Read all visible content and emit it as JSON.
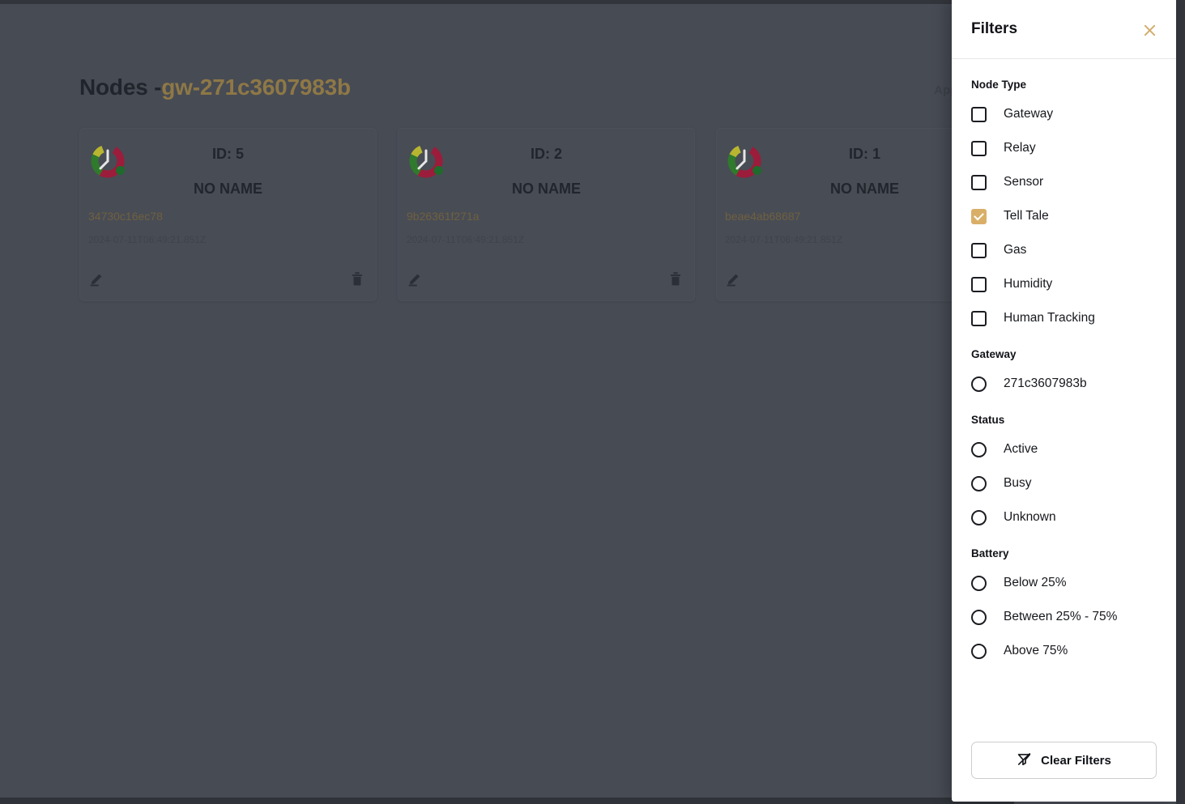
{
  "main": {
    "title_prefix": "Nodes -",
    "gateway_id": "gw-271c3607983b",
    "apply_filters_label": "Apply Filters",
    "cards": [
      {
        "id_label": "ID: 5",
        "name": "NO NAME",
        "mac": "34730c16ec78",
        "timestamp": "2024-07-11T06:49:21.851Z",
        "edit_icon": "pencil-icon",
        "delete_icon": "trash-icon",
        "status_color": "#1f6b2b"
      },
      {
        "id_label": "ID: 2",
        "name": "NO NAME",
        "mac": "9b26361f271a",
        "timestamp": "2024-07-11T06:49:21.851Z",
        "edit_icon": "pencil-icon",
        "delete_icon": "trash-icon",
        "status_color": "#1f6b2b"
      },
      {
        "id_label": "ID: 1",
        "name": "NO NAME",
        "mac": "beae4ab68687",
        "timestamp": "2024-07-11T06:49:21.851Z",
        "edit_icon": "pencil-icon",
        "delete_icon": "trash-icon",
        "status_color": "#1f6b2b"
      }
    ]
  },
  "filters": {
    "title": "Filters",
    "close_icon": "close-icon",
    "accent_color": "#d9af68",
    "sections": {
      "node_type": {
        "label": "Node Type",
        "options": [
          {
            "label": "Gateway",
            "checked": false
          },
          {
            "label": "Relay",
            "checked": false
          },
          {
            "label": "Sensor",
            "checked": false
          },
          {
            "label": "Tell Tale",
            "checked": true
          },
          {
            "label": "Gas",
            "checked": false
          },
          {
            "label": "Humidity",
            "checked": false
          },
          {
            "label": "Human Tracking",
            "checked": false
          }
        ]
      },
      "gateway": {
        "label": "Gateway",
        "options": [
          {
            "label": "271c3607983b",
            "selected": false
          }
        ]
      },
      "status": {
        "label": "Status",
        "options": [
          {
            "label": "Active",
            "selected": false
          },
          {
            "label": "Busy",
            "selected": false
          },
          {
            "label": "Unknown",
            "selected": false
          }
        ]
      },
      "battery": {
        "label": "Battery",
        "options": [
          {
            "label": "Below 25%",
            "selected": false
          },
          {
            "label": "Between 25% - 75%",
            "selected": false
          },
          {
            "label": "Above 75%",
            "selected": false
          }
        ]
      }
    },
    "clear_button": {
      "label": "Clear Filters",
      "icon": "filter-off-icon"
    }
  }
}
